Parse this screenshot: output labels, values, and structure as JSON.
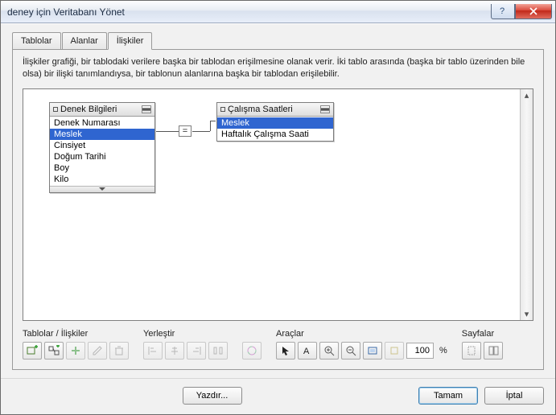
{
  "window": {
    "title": "deney için Veritabanı Yönet"
  },
  "tabs": {
    "tables": "Tablolar",
    "fields": "Alanlar",
    "relations": "İlişkiler"
  },
  "description": "İlişkiler grafiği, bir tablodaki verilere başka bir tablodan erişilmesine olanak verir. İki tablo arasında (başka bir tablo üzerinden bile olsa) bir ilişki tanımlandıysa, bir tablonun alanlarına başka bir tablodan erişilebilir.",
  "tablesCanvas": {
    "left": {
      "title": "Denek Bilgileri",
      "fields": [
        "Denek Numarası",
        "Meslek",
        "Cinsiyet",
        "Doğum Tarihi",
        "Boy",
        "Kilo"
      ],
      "selected": "Meslek"
    },
    "right": {
      "title": "Çalışma Saatleri",
      "fields": [
        "Meslek",
        "Haftalık Çalışma Saati"
      ],
      "selected": "Meslek"
    },
    "join": "="
  },
  "toolbars": {
    "tablesRel": "Tablolar / İlişkiler",
    "place": "Yerleştir",
    "tools": "Araçlar",
    "pages": "Sayfalar",
    "zoom": "100",
    "pct": "%"
  },
  "footer": {
    "print": "Yazdır...",
    "ok": "Tamam",
    "cancel": "İptal"
  }
}
